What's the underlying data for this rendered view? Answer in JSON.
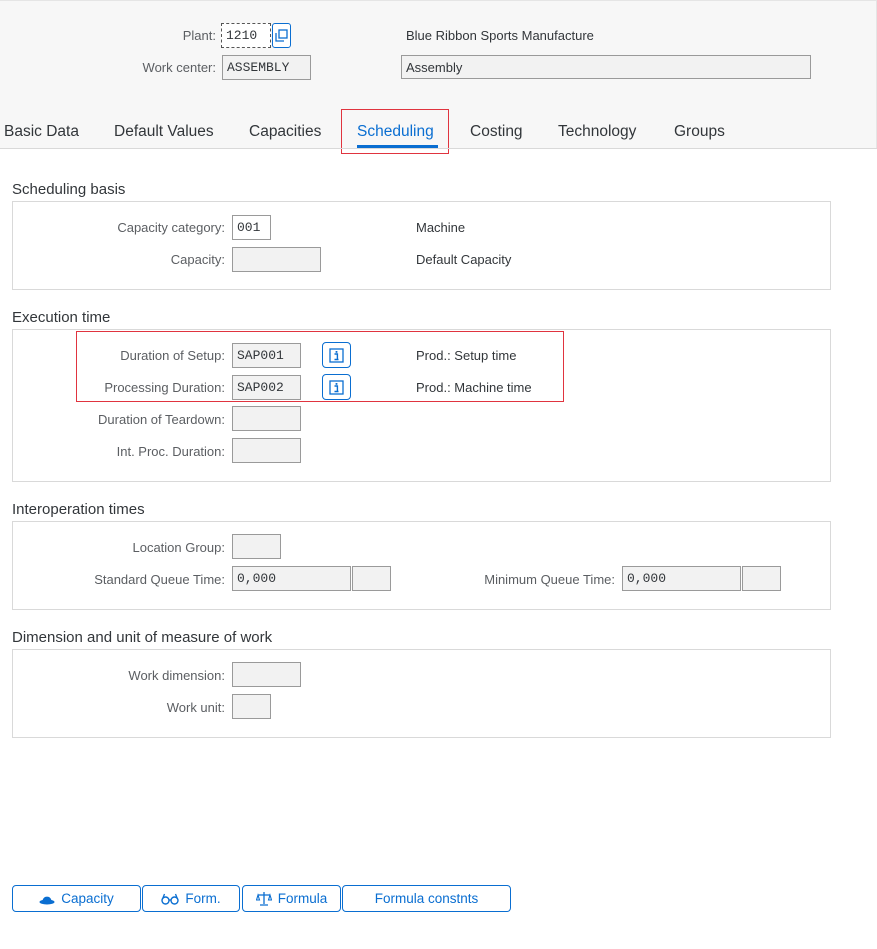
{
  "header": {
    "plant_label": "Plant:",
    "plant_value": "1210",
    "plant_desc": "Blue Ribbon Sports Manufacture",
    "workcenter_label": "Work center:",
    "workcenter_value": "ASSEMBLY",
    "workcenter_desc": "Assembly"
  },
  "tabs": [
    {
      "label": "Basic Data"
    },
    {
      "label": "Default Values"
    },
    {
      "label": "Capacities"
    },
    {
      "label": "Scheduling",
      "active": true
    },
    {
      "label": "Costing"
    },
    {
      "label": "Technology"
    },
    {
      "label": "Groups"
    }
  ],
  "scheduling_basis": {
    "title": "Scheduling basis",
    "capacity_category_label": "Capacity category:",
    "capacity_category_value": "001",
    "capacity_category_desc": "Machine",
    "capacity_label": "Capacity:",
    "capacity_value": "",
    "capacity_desc": "Default Capacity"
  },
  "execution_time": {
    "title": "Execution time",
    "setup_label": "Duration of Setup:",
    "setup_value": "SAP001",
    "setup_desc": "Prod.: Setup time",
    "processing_label": "Processing Duration:",
    "processing_value": "SAP002",
    "processing_desc": "Prod.: Machine time",
    "teardown_label": "Duration of Teardown:",
    "teardown_value": "",
    "intproc_label": "Int. Proc. Duration:",
    "intproc_value": ""
  },
  "interoperation": {
    "title": "Interoperation times",
    "location_group_label": "Location Group:",
    "location_group_value": "",
    "std_queue_label": "Standard Queue Time:",
    "std_queue_value": "0,000",
    "std_queue_unit": "",
    "min_queue_label": "Minimum Queue Time:",
    "min_queue_value": "0,000",
    "min_queue_unit": ""
  },
  "dimension": {
    "title": "Dimension and unit of measure of work",
    "work_dimension_label": "Work dimension:",
    "work_dimension_value": "",
    "work_unit_label": "Work unit:",
    "work_unit_value": ""
  },
  "footer": {
    "capacity_btn": "Capacity",
    "form_btn": "Form.",
    "formula_btn": "Formula",
    "formula_constants_btn": "Formula constnts"
  },
  "colors": {
    "accent": "#0a6ed1",
    "highlight": "#e0343f"
  }
}
